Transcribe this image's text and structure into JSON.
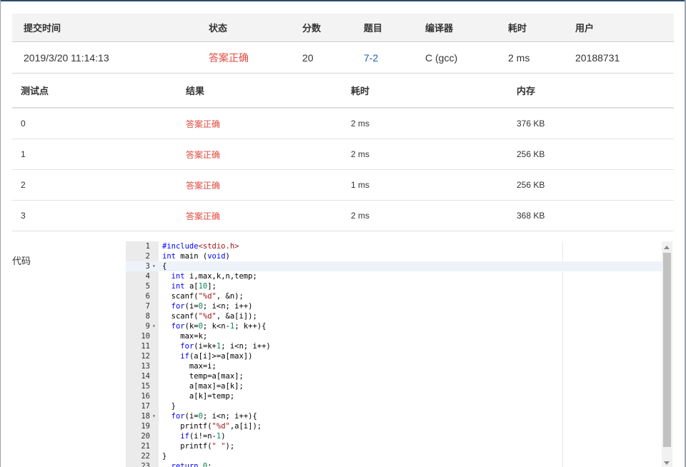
{
  "summary": {
    "headers": [
      "提交时间",
      "状态",
      "分数",
      "题目",
      "编译器",
      "耗时",
      "用户"
    ],
    "submit_time": "2019/3/20 11:14:13",
    "status": "答案正确",
    "score": "20",
    "problem": "7-2",
    "compiler": "C (gcc)",
    "time": "2 ms",
    "user": "20188731"
  },
  "cases": {
    "headers": [
      "测试点",
      "结果",
      "耗时",
      "内存"
    ],
    "rows": [
      {
        "id": "0",
        "result": "答案正确",
        "time": "2 ms",
        "memory": "376 KB"
      },
      {
        "id": "1",
        "result": "答案正确",
        "time": "2 ms",
        "memory": "256 KB"
      },
      {
        "id": "2",
        "result": "答案正确",
        "time": "1 ms",
        "memory": "256 KB"
      },
      {
        "id": "3",
        "result": "答案正确",
        "time": "2 ms",
        "memory": "368 KB"
      }
    ]
  },
  "code": {
    "label": "代码",
    "lines": [
      "#include<stdio.h>",
      "int main (void)",
      "{",
      "  int i,max,k,n,temp;",
      "  int a[10];",
      "  scanf(\"%d\", &n);",
      "  for(i=0; i<n; i++)",
      "  scanf(\"%d\", &a[i]);",
      "  for(k=0; k<n-1; k++){",
      "    max=k;",
      "    for(i=k+1; i<n; i++)",
      "    if(a[i]>=a[max])",
      "      max=i;",
      "      temp=a[max];",
      "      a[max]=a[k];",
      "      a[k]=temp;",
      "  }",
      "  for(i=0; i<n; i++){",
      "    printf(\"%d\",a[i]);",
      "    if(i!=n-1)",
      "    printf(\" \");",
      "}",
      "  return 0;"
    ],
    "fold_lines": [
      3,
      9,
      18
    ],
    "active_line": 3
  },
  "colors": {
    "status_ok": "#e04b3f",
    "link": "#1f5fa8",
    "header_bg": "#f3f3f3",
    "gutter_bg": "#ebebeb"
  }
}
